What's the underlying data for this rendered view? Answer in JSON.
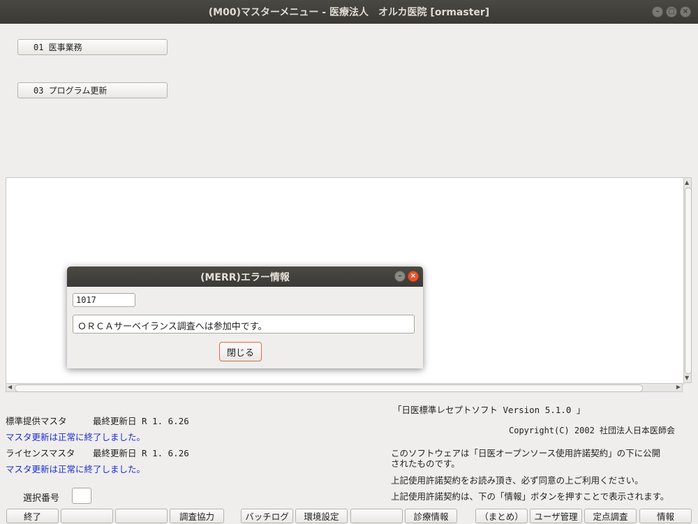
{
  "window": {
    "title": "(M00)マスターメニュー - 医療法人　オルカ医院  [ormaster]"
  },
  "menu": {
    "items": [
      {
        "label": "01  医事業務"
      },
      {
        "label": "03  プログラム更新"
      }
    ]
  },
  "status": {
    "std_master_label": "標準提供マスタ",
    "std_master_date": "最終更新日 R 1. 6.26",
    "std_master_msg": "マスタ更新は正常に終了しました。",
    "license_master_label": "ライセンスマスタ",
    "license_master_date": "最終更新日 R 1. 6.26",
    "license_master_msg": "マスタ更新は正常に終了しました。"
  },
  "about": {
    "product": "「日医標準レセプトソフト  Version  5.1.0 」",
    "copyright": "Copyright(C) 2002 社団法人日本医師会",
    "license_line1": "このソフトウェアは「日医オープンソース使用許諾契約」の下に公開",
    "license_line2": "されたものです。",
    "license_line3": "上記使用許諾契約をお読み頂き、必ず同意の上ご利用ください。",
    "license_line4": "上記使用許諾契約は、下の「情報」ボタンを押すことで表示されます。"
  },
  "selection": {
    "label": "選択番号",
    "value": ""
  },
  "footer": {
    "buttons": [
      "終了",
      "",
      "",
      "調査協力",
      "バッチログ",
      "環境設定",
      "",
      "診療情報",
      "（まとめ）",
      "ユーザ管理",
      "定点調査",
      "情報"
    ]
  },
  "dialog": {
    "title": "(MERR)エラー情報",
    "code": "1017",
    "message": "ＯＲＣＡサーベイランス調査へは参加中です。",
    "close_label": "閉じる"
  },
  "colors": {
    "titlebar": "#3c3b37",
    "status_blue": "#1c2bd9",
    "close_accent": "#e6572b"
  }
}
